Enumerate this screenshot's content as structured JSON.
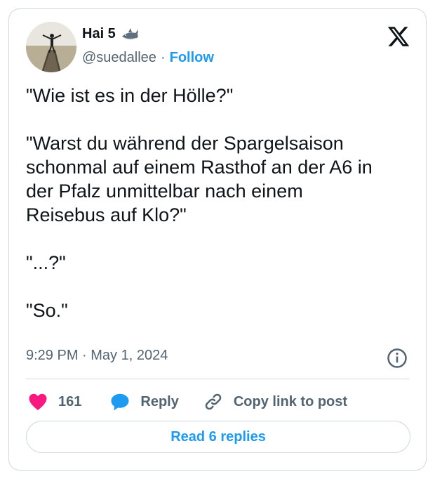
{
  "author": {
    "display_name": "Hai 5",
    "handle": "@suedallee",
    "separator": "·",
    "follow_label": "Follow",
    "avatar_icon": "profile-photo-pier",
    "name_emoji": "shark-emoji"
  },
  "tweet": {
    "paragraphs": [
      {
        "lines": [
          "\"Wie ist es in der Hölle?\""
        ]
      },
      {
        "lines": [
          "\"Warst du während der Spargelsaison",
          "schonmal auf einem Rasthof an der A6 in",
          "der Pfalz unmittelbar nach einem",
          "Reisebus auf Klo?\""
        ]
      },
      {
        "lines": [
          "\"...?\""
        ]
      },
      {
        "lines": [
          "\"So.\""
        ]
      }
    ],
    "timestamp": "9:29 PM · May 1, 2024"
  },
  "actions": {
    "likes_count": "161",
    "reply_label": "Reply",
    "copy_label": "Copy link to post"
  },
  "footer": {
    "read_replies_label": "Read 6 replies"
  },
  "colors": {
    "accent": "#1d9bf0",
    "heart": "#f91880",
    "text": "#0f1419",
    "muted": "#536471",
    "border": "#cfd9de"
  }
}
